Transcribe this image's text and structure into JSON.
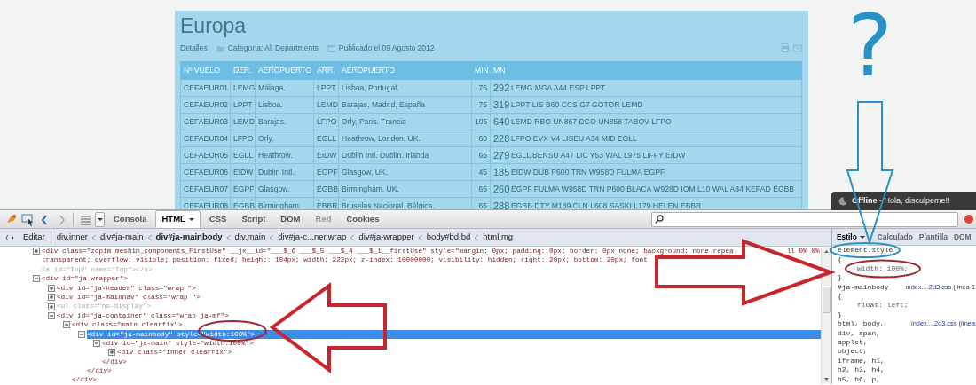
{
  "page": {
    "title": "Europa",
    "meta": [
      {
        "kind": "label",
        "text": "Detalles"
      },
      {
        "kind": "category",
        "text": "Categoría: All Departments"
      },
      {
        "kind": "date",
        "text": "Publicado el 09 Agosto 2012"
      }
    ],
    "table": {
      "columns": [
        "Nº VUELO",
        "DER.",
        "AEROPUERTO",
        "ARR.",
        "AEROPUERTO",
        "MIN.",
        "MN"
      ],
      "rows": [
        [
          "CEFAEUR01",
          "LEMG",
          "Málaga.",
          "LPPT",
          "Lisboa, Portugal.",
          "75",
          "292",
          "LEMG MGA A44 ESP LPPT"
        ],
        [
          "CEFAEUR02",
          "LPPT",
          "Lisboa.",
          "LEMD",
          "Barajas, Madrid, España",
          "75",
          "319",
          "LPPT LIS B60 CCS G7 GOTOR LEMD"
        ],
        [
          "CEFAEUR03",
          "LEMD",
          "Barajas.",
          "LFPO",
          "Orly, Paris. Francia",
          "105",
          "640",
          "LEMD RBO UN867 DGO UN858 TABOV LFPO"
        ],
        [
          "CEFAEUR04",
          "LFPO",
          "Orly.",
          "EGLL",
          "Heathrow, London. UK.",
          "60",
          "228",
          "LFPO EVX V4 LISEU A34 MID EGLL"
        ],
        [
          "CEFAEUR05",
          "EGLL",
          "Heathrow.",
          "EIDW",
          "Dublin Intl. Dublin. Irlanda",
          "65",
          "279",
          "EGLL BENSU A47 LIC Y53 WAL L975 LIFFY EIDW"
        ],
        [
          "CEFAEUR06",
          "EIDW",
          "Dublin Intl.",
          "EGPF",
          "Glasgow, UK.",
          "45",
          "185",
          "EIDW DUB P600 TRN W958D FULMA EGPF"
        ],
        [
          "CEFAEUR07",
          "EGPF",
          "Glasgow.",
          "EGBB",
          "Birmingham. UK.",
          "65",
          "260",
          "EGPF FULMA W958D TRN P600 BLACA W928D IOM L10 WAL A34 KEPAD EGBB"
        ],
        [
          "CEFAEUR08",
          "EGBB",
          "Birmingham.",
          "EBBR",
          "Bruselas Nacional. Bélgica..",
          "65",
          "288",
          "EGBB DTY M189 CLN L608 SASKI L179 HELEN EBBR"
        ]
      ]
    }
  },
  "chat": {
    "text": "**Offline** - Hola, disculpeme!!"
  },
  "annotation": {
    "question_mark": "?"
  },
  "firebug": {
    "tabs": [
      {
        "label": "Consola",
        "selected": false,
        "disabled": false,
        "dropdown": false
      },
      {
        "label": "HTML",
        "selected": true,
        "disabled": false,
        "dropdown": true
      },
      {
        "label": "CSS",
        "selected": false,
        "disabled": false,
        "dropdown": false
      },
      {
        "label": "Script",
        "selected": false,
        "disabled": false,
        "dropdown": false
      },
      {
        "label": "DOM",
        "selected": false,
        "disabled": false,
        "dropdown": false
      },
      {
        "label": "Red",
        "selected": false,
        "disabled": true,
        "dropdown": false
      },
      {
        "label": "Cookies",
        "selected": false,
        "disabled": false,
        "dropdown": false
      }
    ],
    "breadcrumb": {
      "edit_button": "Editar",
      "items": [
        {
          "label": "div.inner",
          "selected": false
        },
        {
          "label": "div#ja-main",
          "selected": false
        },
        {
          "label": "div#ja-mainbody",
          "selected": true
        },
        {
          "label": "div.main",
          "selected": false
        },
        {
          "label": "div#ja-c...ner.wrap",
          "selected": false
        },
        {
          "label": "div#ja-wrapper",
          "selected": false
        },
        {
          "label": "body#bd.bd",
          "selected": false
        },
        {
          "label": "html.mg",
          "selected": false
        }
      ]
    },
    "tree": [
      {
        "text": "<div class=\"zopim meshim_components_FirstUse\" __jx__id=\"___$_6 ___$_5 ___$_4 ___$_1__firstUse\" style=\"margin: 0px; padding: 0px; border: 0px none; background: none repea",
        "tail": "ll 0% 0%",
        "continuation": "transparent; overflow: visible; position: fixed; height: 104px; width: 222px; z-index: 10000000; visibility: hidden; right: 20px; bottom: 20px; font",
        "expanded": false,
        "hidden": false,
        "selected": false
      },
      {
        "text": "<a id=\"Top\" name=\"Top\"></a>",
        "hidden": true,
        "selected": false
      },
      {
        "text": "<div id=\"ja-wrapper\">",
        "expanded": true,
        "hidden": false,
        "selected": false,
        "children": [
          {
            "text": "<div id=\"ja-header\" class=\"wrap \">",
            "expanded": false,
            "hidden": false,
            "selected": false
          },
          {
            "text": "<div id=\"ja-mainnav\" class=\"wrap \">",
            "expanded": false,
            "hidden": false,
            "selected": false
          },
          {
            "text": "<ul class=\"no-display\">",
            "expanded": false,
            "hidden": true,
            "selected": false
          },
          {
            "text": "<div id=\"ja-container\" class=\"wrap ja-mf\">",
            "expanded": true,
            "hidden": false,
            "selected": false,
            "children": [
              {
                "text": "<div class=\"main clearfix\">",
                "expanded": true,
                "hidden": false,
                "selected": false,
                "close": "</div>",
                "children": [
                  {
                    "text": "<div id=\"ja-mainbody\" style=\"width:100%\">",
                    "expanded": true,
                    "hidden": false,
                    "selected": true,
                    "close": "</div>",
                    "children": [
                      {
                        "text": "<div id=\"ja-main\" style=\"width:100%\">",
                        "expanded": true,
                        "hidden": false,
                        "selected": false,
                        "close": "</div>",
                        "children": [
                          {
                            "text": "<div class=\"inner clearfix\">",
                            "expanded": false,
                            "hidden": false,
                            "selected": false
                          }
                        ]
                      }
                    ]
                  }
                ]
              }
            ]
          }
        ]
      }
    ],
    "side_panel": {
      "tabs": [
        {
          "label": "Estilo",
          "selected": true,
          "dropdown": true
        },
        {
          "label": "Calculado",
          "selected": false,
          "dropdown": false
        },
        {
          "label": "Plantilla",
          "selected": false,
          "dropdown": false
        },
        {
          "label": "DOM",
          "selected": false,
          "dropdown": false
        }
      ],
      "lines": [
        {
          "kind": "selector",
          "text": "element.style"
        },
        {
          "kind": "brace",
          "text": "{"
        },
        {
          "kind": "declaration",
          "text": "width: 100%;"
        },
        {
          "kind": "brace",
          "text": "}"
        },
        {
          "kind": "selector",
          "text": "#ja-mainbody",
          "source": "index....2d3.css (línea 1"
        },
        {
          "kind": "brace",
          "text": "{"
        },
        {
          "kind": "declaration",
          "text": "float: left;"
        },
        {
          "kind": "brace",
          "text": "}"
        },
        {
          "kind": "selector",
          "text": "html, body,",
          "source": "index....2d3.css (línea"
        },
        {
          "kind": "selector",
          "text": "div, span,"
        },
        {
          "kind": "selector",
          "text": "applet,"
        },
        {
          "kind": "selector",
          "text": "object,"
        },
        {
          "kind": "selector",
          "text": "iframe, h1,"
        },
        {
          "kind": "selector",
          "text": "h2, h3, h4,"
        },
        {
          "kind": "selector",
          "text": "h5, h6, p,"
        }
      ]
    }
  }
}
